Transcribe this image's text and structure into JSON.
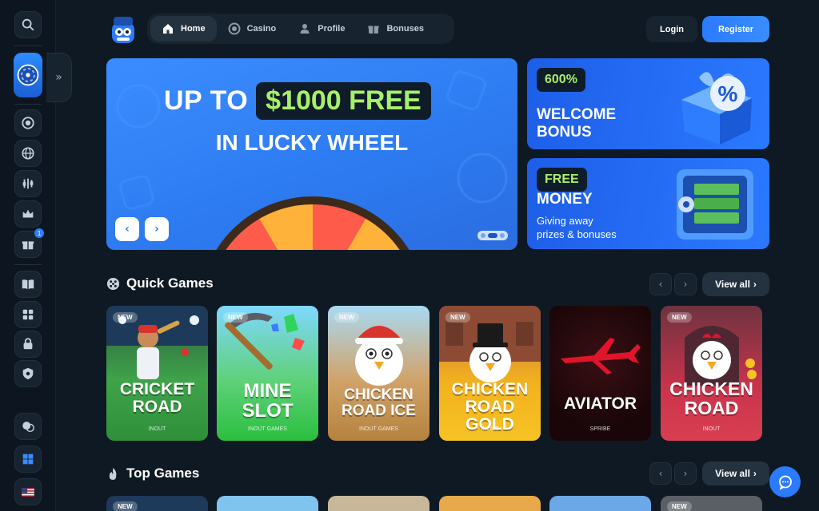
{
  "header": {
    "nav": [
      {
        "label": "Home",
        "icon": "home-icon",
        "active": true
      },
      {
        "label": "Casino",
        "icon": "chip-icon",
        "active": false
      },
      {
        "label": "Profile",
        "icon": "user-icon",
        "active": false
      },
      {
        "label": "Bonuses",
        "icon": "gift-icon",
        "active": false
      }
    ],
    "login_label": "Login",
    "register_label": "Register"
  },
  "hero": {
    "line1_prefix": "UP TO",
    "line1_highlight": "$1000 FREE",
    "line2": "IN LUCKY WHEEL",
    "prev_icon": "chevron-left-icon",
    "next_icon": "chevron-right-icon",
    "slides_total": 3,
    "active_slide": 2
  },
  "promos": [
    {
      "pill": "600%",
      "title_line1": "WELCOME",
      "title_line2": "BONUS",
      "icon": "gift-box-percent-icon"
    },
    {
      "pill": "FREE",
      "title_line1": "MONEY",
      "subtitle_line1": "Giving away",
      "subtitle_line2": "prizes & bonuses",
      "icon": "safe-money-icon"
    }
  ],
  "quick_games": {
    "title": "Quick Games",
    "view_all": "View all",
    "games": [
      {
        "name": "CRICKET\nROAD",
        "provider": "INOUT",
        "badge": "NEW"
      },
      {
        "name": "MINE\nSLOT",
        "provider": "INOUT GAMES",
        "badge": "NEW"
      },
      {
        "name": "CHICKEN\nROAD ICE",
        "provider": "INOUT GAMES",
        "badge": "NEW"
      },
      {
        "name": "CHICKEN\nROAD GOLD",
        "provider": "INOUT",
        "badge": "NEW"
      },
      {
        "name": "AVIATOR",
        "provider": "SPRIBE",
        "badge": ""
      },
      {
        "name": "CHICKEN\nROAD",
        "provider": "INOUT",
        "badge": "NEW"
      }
    ]
  },
  "top_games": {
    "title": "Top Games",
    "view_all": "View all",
    "peek_badges": [
      "NEW",
      "",
      "",
      "",
      "",
      "NEW"
    ]
  },
  "sidebar": {
    "icons": [
      "search-icon",
      "lucky-wheel-icon",
      "chip-icon",
      "globe-icon",
      "sports-icon",
      "crown-icon",
      "gift-icon",
      "book-icon",
      "games-icon",
      "lock-icon",
      "shield-icon",
      "support-icon",
      "windows-icon",
      "us-flag-icon"
    ],
    "gift_badge": "1"
  },
  "colors": {
    "background": "#0f1923",
    "accent": "#2a7bff",
    "highlight_green": "#a8f06a"
  }
}
